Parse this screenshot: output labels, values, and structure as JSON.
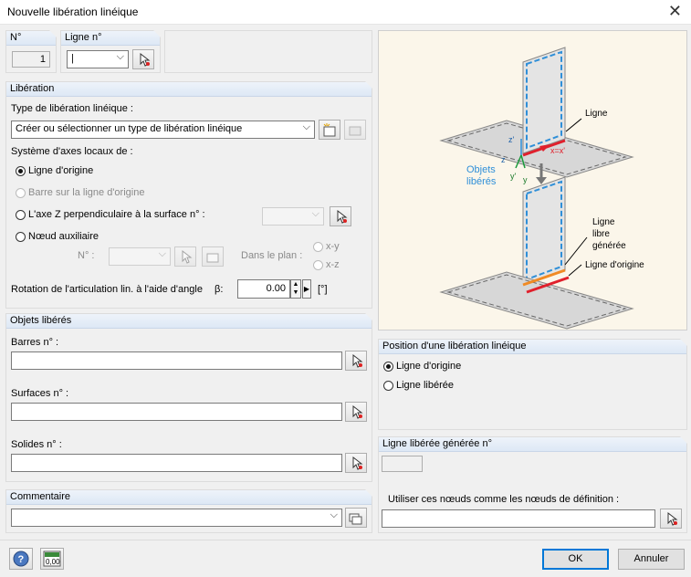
{
  "window": {
    "title": "Nouvelle libération linéique"
  },
  "header": {
    "no_label": "N°",
    "no_value": "1",
    "line_label": "Ligne n°",
    "line_value": "|"
  },
  "liberation": {
    "title": "Libération",
    "type_label": "Type de libération linéique :",
    "type_value": "Créer ou sélectionner un type de libération linéique",
    "axes_label": "Système d'axes locaux de :",
    "opt_origin": "Ligne d'origine",
    "opt_bar": "Barre sur la ligne d'origine",
    "opt_z_axis": "L'axe Z perpendiculaire à la surface n° :",
    "opt_node": "Nœud auxiliaire",
    "node_no_label": "N° :",
    "plane_label": "Dans le plan :",
    "plane_xy": "x-y",
    "plane_xz": "x-z",
    "rotation_label": "Rotation de l'articulation lin. à l'aide d'angle",
    "beta_label": "β:",
    "beta_value": "0.00",
    "beta_unit": "[°]"
  },
  "objects": {
    "title": "Objets libérés",
    "bars_label": "Barres n° :",
    "surfaces_label": "Surfaces n° :",
    "solids_label": "Solides n° :"
  },
  "comment": {
    "title": "Commentaire"
  },
  "diagram": {
    "label_ligne": "Ligne",
    "label_xx": "x=x'",
    "label_z": "z",
    "label_zp": "z'",
    "label_y": "y",
    "label_yp": "y'",
    "label_objets": "Objets",
    "label_liberes": "libérés",
    "label_libre_1": "Ligne",
    "label_libre_2": "libre",
    "label_libre_3": "générée",
    "label_origine": "Ligne d'origine"
  },
  "position": {
    "title": "Position d'une libération linéique",
    "opt_origin": "Ligne d'origine",
    "opt_freed": "Ligne libérée"
  },
  "generated": {
    "title": "Ligne libérée générée n°",
    "use_nodes_label": "Utiliser ces nœuds comme les nœuds de définition :"
  },
  "footer": {
    "ok": "OK",
    "cancel": "Annuler",
    "calc_icon_text": "0,00"
  },
  "colors": {
    "accent": "#0078d7",
    "line_red": "#e0202c",
    "dash_blue": "#2f8fd8",
    "free_orange": "#f08a24"
  }
}
